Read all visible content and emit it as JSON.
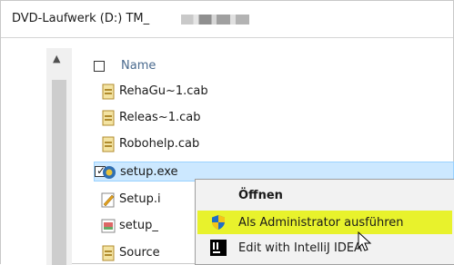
{
  "address_bar": {
    "path": "DVD-Laufwerk (D:) TM_"
  },
  "file_list": {
    "header_name": "Name",
    "files": [
      {
        "name": "RehaGu~1.cab",
        "icon": "cab-file-icon"
      },
      {
        "name": "Releas~1.cab",
        "icon": "cab-file-icon"
      },
      {
        "name": "Robohelp.cab",
        "icon": "cab-file-icon"
      },
      {
        "name": "setup.exe",
        "icon": "setup-exe-icon",
        "selected": true
      },
      {
        "name": "Setup.i",
        "icon": "setup-ini-icon"
      },
      {
        "name": "setup_",
        "icon": "setup-image-icon"
      },
      {
        "name": "Source",
        "icon": "cab-file-icon"
      }
    ]
  },
  "context_menu": {
    "items": [
      {
        "label": "Öffnen",
        "bold": true
      },
      {
        "label": "Als Administrator ausführen",
        "icon": "uac-shield-icon",
        "highlighted": true
      },
      {
        "label": "Edit with IntelliJ IDEA",
        "icon": "intellij-icon"
      }
    ]
  },
  "colors": {
    "selection_bg": "#cce8ff",
    "menu_highlight": "#e8f22c",
    "header_text": "#4a6a8e"
  }
}
